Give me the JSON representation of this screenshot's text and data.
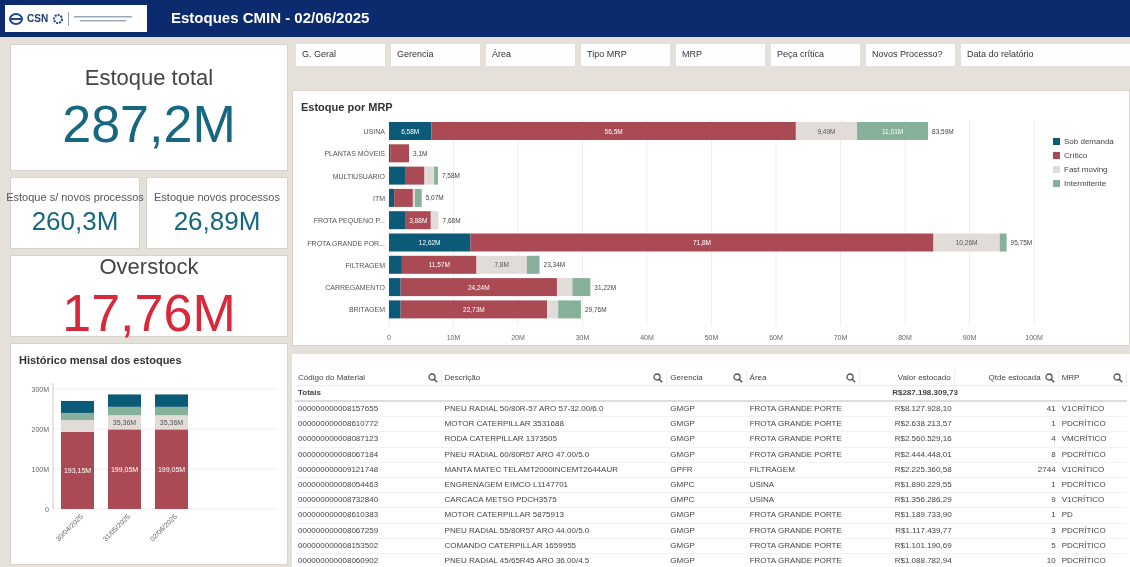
{
  "header": {
    "logo_text": "CSN",
    "title": "Estoques CMIN - 02/06/2025"
  },
  "kpis": {
    "total": {
      "label": "Estoque total",
      "value": "287,2M"
    },
    "sem_novos": {
      "label": "Estoque s/ novos processos",
      "value": "260,3M"
    },
    "novos": {
      "label": "Estoque novos processos",
      "value": "26,89M"
    },
    "overstock": {
      "label": "Overstock",
      "value": "17,76M"
    }
  },
  "filters": [
    "G. Geral",
    "Gerencia",
    "Área",
    "Tipo MRP",
    "MRP",
    "Peça crítica",
    "Novos Processo?",
    "Data do relatório"
  ],
  "mrp_chart": {
    "title": "Estoque por MRP",
    "chart_data": {
      "type": "bar",
      "orientation": "horizontal",
      "stacked": true,
      "grid": true,
      "categories": [
        "USINA",
        "PLANTAS MÓVEIS",
        "MULTIUSUARIO",
        "ITM",
        "FROTA PEQUENO P...",
        "FROTA GRANDE POR...",
        "FILTRAGEM",
        "CARREGAMENTO",
        "BRITAGEM"
      ],
      "series": [
        {
          "name": "Sob demanda",
          "color": "#0b5a78",
          "values": [
            6.58,
            0.2,
            2.6,
            0.8,
            2.6,
            12.62,
            2.0,
            1.8,
            1.8
          ]
        },
        {
          "name": "Crítico",
          "color": "#a94a55",
          "values": [
            56.5,
            2.9,
            2.9,
            2.9,
            3.88,
            71.8,
            11.57,
            24.24,
            22.73
          ]
        },
        {
          "name": "Fast moving",
          "color": "#e2dcd8",
          "values": [
            9.49,
            0,
            1.5,
            0.3,
            1.2,
            10.26,
            7.8,
            2.4,
            1.7
          ]
        },
        {
          "name": "Intermitente",
          "color": "#86b09a",
          "values": [
            11.01,
            0,
            0.58,
            1.07,
            0,
            1.07,
            1.97,
            2.78,
            3.53
          ]
        }
      ],
      "xlim": [
        0,
        100
      ],
      "xticks": [
        {
          "value": 0,
          "label": "0"
        },
        {
          "value": 10,
          "label": "10M"
        },
        {
          "value": 20,
          "label": "20M"
        },
        {
          "value": 30,
          "label": "30M"
        },
        {
          "value": 40,
          "label": "40M"
        },
        {
          "value": 50,
          "label": "50M"
        },
        {
          "value": 60,
          "label": "60M"
        },
        {
          "value": 70,
          "label": "70M"
        },
        {
          "value": 80,
          "label": "80M"
        },
        {
          "value": 90,
          "label": "90M"
        },
        {
          "value": 100,
          "label": "100M"
        }
      ],
      "annotations": [
        "6,58M",
        "56,5M",
        "9,49M",
        "11,01M",
        "3,88M",
        "12,62M",
        "71,8M",
        "10,26M",
        "11,57M",
        "7,8M",
        "24,24M",
        "22,73M",
        "83,59M",
        "3,1M",
        "7,58M",
        "5,07M",
        "7,68M",
        "95,75M",
        "23,34M",
        "31,22M",
        "29,76M"
      ]
    }
  },
  "history_chart": {
    "title": "Histórico mensal dos estoques",
    "chart_data": {
      "type": "bar",
      "stacked": true,
      "grid": true,
      "categories": [
        "30/04/2025",
        "31/05/2025",
        "02/06/2025"
      ],
      "series": [
        {
          "color": "#a94a55",
          "values": [
            193.15,
            199.05,
            199.05
          ]
        },
        {
          "color": "#e2dcd8",
          "values": [
            29,
            35.36,
            35.36
          ]
        },
        {
          "color": "#86b09a",
          "values": [
            18,
            21,
            21
          ]
        },
        {
          "color": "#0b5a78",
          "values": [
            30,
            31,
            31
          ]
        }
      ],
      "ylim": [
        0,
        300
      ],
      "yticks": [
        {
          "value": 0,
          "label": "0"
        },
        {
          "value": 100,
          "label": "100M"
        },
        {
          "value": 200,
          "label": "200M"
        },
        {
          "value": 300,
          "label": "300M"
        }
      ],
      "annotations": [
        "193,15M",
        "199,05M",
        "199,05M",
        "35,36M",
        "35,36M"
      ]
    }
  },
  "table": {
    "columns": [
      {
        "label": "Código do Material",
        "search": true
      },
      {
        "label": "Descrição",
        "search": true
      },
      {
        "label": "Gerencia",
        "search": true
      },
      {
        "label": "Área",
        "search": true
      },
      {
        "label": "Valor estocado",
        "search": false
      },
      {
        "label": "Qtde estocada",
        "search": true
      },
      {
        "label": "MRP",
        "search": true
      }
    ],
    "totals": {
      "label": "Totais",
      "valor": "R$287.198.309,73"
    },
    "rows": [
      [
        "000000000008157655",
        "PNEU RADIAL 50/80R-57 ARO 57-32.00/6.0",
        "GMGP",
        "FROTA GRANDE PORTE",
        "R$8.127.928,10",
        "41",
        "V1CRÍTICO"
      ],
      [
        "000000000008610772",
        "MOTOR CATERPILLAR 3531688",
        "GMGP",
        "FROTA GRANDE PORTE",
        "R$2.638.213,57",
        "1",
        "PDCRÍTICO"
      ],
      [
        "000000000008087123",
        "RODA CATERPILLAR 1373505",
        "GMGP",
        "FROTA GRANDE PORTE",
        "R$2.560.529,16",
        "4",
        "VMCRÍTICO"
      ],
      [
        "000000000008067184",
        "PNEU RADIAL 60/80R57 ARO 47.00/5.0",
        "GMGP",
        "FROTA GRANDE PORTE",
        "R$2.444.448,01",
        "8",
        "PDCRÍTICO"
      ],
      [
        "000000000009121748",
        "MANTA MATEC TELAMT2000INCEMT2644AUR",
        "GPFR",
        "FILTRAGEM",
        "R$2.225.360,58",
        "2744",
        "V1CRÍTICO"
      ],
      [
        "000000000008054463",
        "ENGRENAGEM EIMCO L1147701",
        "GMPC",
        "USINA",
        "R$1.890.229,55",
        "1",
        "PDCRÍTICO"
      ],
      [
        "000000000008732840",
        "CARCACA METSO PDCH3575",
        "GMPC",
        "USINA",
        "R$1.356.286,29",
        "9",
        "V1CRÍTICO"
      ],
      [
        "000000000008610383",
        "MOTOR CATERPILLAR 5875913",
        "GMGP",
        "FROTA GRANDE PORTE",
        "R$1.189.733,90",
        "1",
        "PD"
      ],
      [
        "000000000008067259",
        "PNEU RADIAL 55/80R57 ARO 44.00/5.0",
        "GMGP",
        "FROTA GRANDE PORTE",
        "R$1.117.439,77",
        "3",
        "PDCRÍTICO"
      ],
      [
        "000000000008153502",
        "COMANDO CATERPILLAR 1659955",
        "GMGP",
        "FROTA GRANDE PORTE",
        "R$1.101.190,69",
        "5",
        "PDCRÍTICO"
      ],
      [
        "000000000008060902",
        "PNEU RADIAL 45/65R45 ARO 36.00/4.5",
        "GMGP",
        "FROTA GRANDE PORTE",
        "R$1.088.782,94",
        "10",
        "PDCRÍTICO"
      ]
    ]
  }
}
